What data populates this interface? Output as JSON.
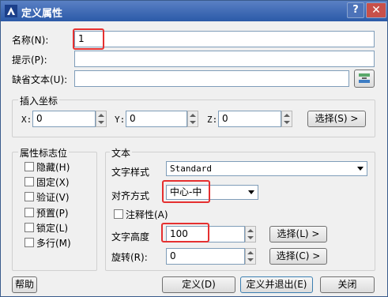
{
  "window": {
    "title": "定义属性",
    "help_glyph": "?",
    "close_glyph": "✕"
  },
  "name_row": {
    "label": "名称(N):",
    "value": "1"
  },
  "prompt_row": {
    "label": "提示(P):",
    "value": ""
  },
  "default_row": {
    "label": "缺省文本(U):",
    "value": ""
  },
  "insert": {
    "title": "插入坐标",
    "x_label": "X:",
    "x_value": "0",
    "y_label": "Y:",
    "y_value": "0",
    "z_label": "Z:",
    "z_value": "0",
    "select_label": "选择(S) >"
  },
  "flags": {
    "title": "属性标志位",
    "items": [
      "隐藏(H)",
      "固定(X)",
      "验证(V)",
      "预置(P)",
      "锁定(L)",
      "多行(M)"
    ]
  },
  "text": {
    "title": "文本",
    "style_label": "文字样式",
    "style_value": "Standard",
    "align_label": "对齐方式",
    "align_value": "中心-中",
    "annotative_label": "注释性(A)",
    "height_label": "文字高度",
    "height_value": "100",
    "height_select": "选择(L) >",
    "rotation_label": "旋转(R):",
    "rotation_value": "0",
    "rotation_select": "选择(C) >"
  },
  "footer": {
    "help": "帮助",
    "define": "定义(D)",
    "define_exit": "定义并退出(E)",
    "close": "关闭"
  },
  "colors": {
    "highlight": "#e53030",
    "titlebar": "#2b5aa8"
  }
}
